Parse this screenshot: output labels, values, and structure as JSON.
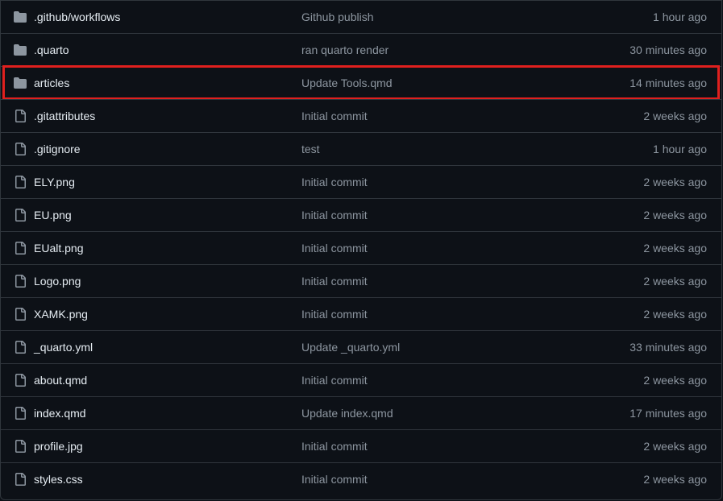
{
  "colors": {
    "background": "#0d1117",
    "border": "#30363d",
    "folder_icon": "#8d96a0",
    "file_icon": "#8d96a0",
    "name_text": "#e6edf3",
    "muted_text": "#8d96a0",
    "highlight": "#e0201e"
  },
  "files": [
    {
      "type": "folder",
      "icon": "folder-icon",
      "name": ".github/workflows",
      "commit": "Github publish",
      "age": "1 hour ago"
    },
    {
      "type": "folder",
      "icon": "folder-icon",
      "name": ".quarto",
      "commit": "ran quarto render",
      "age": "30 minutes ago"
    },
    {
      "type": "folder",
      "icon": "folder-icon",
      "name": "articles",
      "commit": "Update Tools.qmd",
      "age": "14 minutes ago"
    },
    {
      "type": "file",
      "icon": "file-icon",
      "name": ".gitattributes",
      "commit": "Initial commit",
      "age": "2 weeks ago"
    },
    {
      "type": "file",
      "icon": "file-icon",
      "name": ".gitignore",
      "commit": "test",
      "age": "1 hour ago"
    },
    {
      "type": "file",
      "icon": "file-icon",
      "name": "ELY.png",
      "commit": "Initial commit",
      "age": "2 weeks ago"
    },
    {
      "type": "file",
      "icon": "file-icon",
      "name": "EU.png",
      "commit": "Initial commit",
      "age": "2 weeks ago"
    },
    {
      "type": "file",
      "icon": "file-icon",
      "name": "EUalt.png",
      "commit": "Initial commit",
      "age": "2 weeks ago"
    },
    {
      "type": "file",
      "icon": "file-icon",
      "name": "Logo.png",
      "commit": "Initial commit",
      "age": "2 weeks ago"
    },
    {
      "type": "file",
      "icon": "file-icon",
      "name": "XAMK.png",
      "commit": "Initial commit",
      "age": "2 weeks ago"
    },
    {
      "type": "file",
      "icon": "file-icon",
      "name": "_quarto.yml",
      "commit": "Update _quarto.yml",
      "age": "33 minutes ago"
    },
    {
      "type": "file",
      "icon": "file-icon",
      "name": "about.qmd",
      "commit": "Initial commit",
      "age": "2 weeks ago"
    },
    {
      "type": "file",
      "icon": "file-icon",
      "name": "index.qmd",
      "commit": "Update index.qmd",
      "age": "17 minutes ago"
    },
    {
      "type": "file",
      "icon": "file-icon",
      "name": "profile.jpg",
      "commit": "Initial commit",
      "age": "2 weeks ago"
    },
    {
      "type": "file",
      "icon": "file-icon",
      "name": "styles.css",
      "commit": "Initial commit",
      "age": "2 weeks ago"
    }
  ]
}
